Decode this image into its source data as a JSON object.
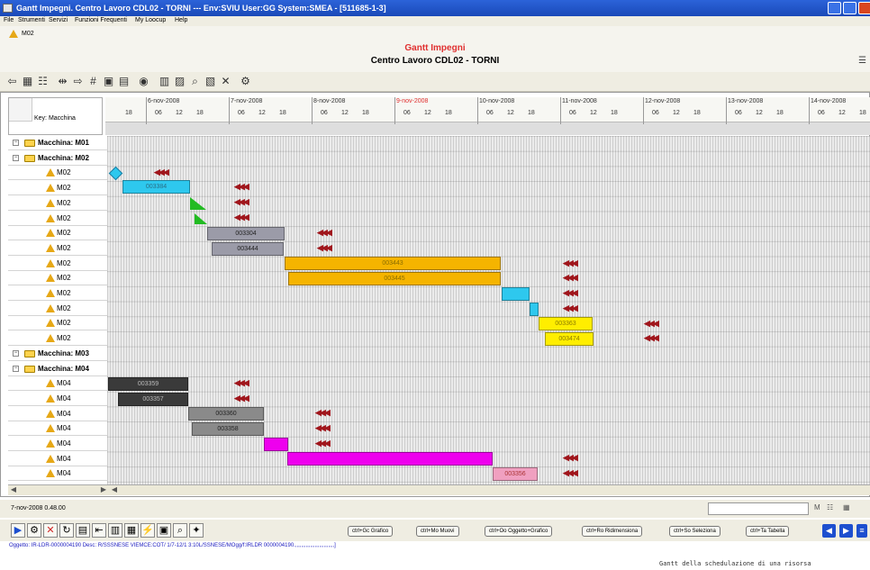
{
  "window": {
    "title": "Gantt Impegni. Centro Lavoro CDL02 - TORNI --- Env:SVIU User:GG System:SMEA - [511685-1-3]"
  },
  "menu": {
    "items": [
      "File",
      "Strumenti",
      "Servizi",
      "Funzioni Frequenti",
      "My Loocup",
      "Help"
    ]
  },
  "doc": {
    "label": "M02"
  },
  "header": {
    "title": "Gantt Impegni",
    "subtitle": "Centro Lavoro CDL02 - TORNI"
  },
  "grid": {
    "key_label": "Key: Macchina",
    "days": [
      "6-nov-2008",
      "7-nov-2008",
      "8-nov-2008",
      "9-nov-2008",
      "10-nov-2008",
      "11-nov-2008",
      "12-nov-2008",
      "13-nov-2008",
      "14-nov-2008"
    ],
    "highlighted_day": "9-nov-2008",
    "hours": [
      "06",
      "12",
      "18"
    ],
    "first_hour": "18"
  },
  "rows": [
    {
      "type": "group",
      "label": "Macchina: M01"
    },
    {
      "type": "group",
      "label": "Macchina: M02"
    },
    {
      "type": "item",
      "label": "M02"
    },
    {
      "type": "item",
      "label": "M02"
    },
    {
      "type": "item",
      "label": "M02"
    },
    {
      "type": "item",
      "label": "M02"
    },
    {
      "type": "item",
      "label": "M02"
    },
    {
      "type": "item",
      "label": "M02"
    },
    {
      "type": "item",
      "label": "M02"
    },
    {
      "type": "item",
      "label": "M02"
    },
    {
      "type": "item",
      "label": "M02"
    },
    {
      "type": "item",
      "label": "M02"
    },
    {
      "type": "item",
      "label": "M02"
    },
    {
      "type": "item",
      "label": "M02"
    },
    {
      "type": "group",
      "label": "Macchina: M03"
    },
    {
      "type": "group",
      "label": "Macchina: M04"
    },
    {
      "type": "item",
      "label": "M04"
    },
    {
      "type": "item",
      "label": "M04"
    },
    {
      "type": "item",
      "label": "M04"
    },
    {
      "type": "item",
      "label": "M04"
    },
    {
      "type": "item",
      "label": "M04"
    },
    {
      "type": "item",
      "label": "M04"
    },
    {
      "type": "item",
      "label": "M04"
    }
  ],
  "bars": {
    "b1": "003384",
    "b2": "003304",
    "b3": "003444",
    "b4": "003443",
    "b5": "003445",
    "b6": "003363",
    "b7": "003474",
    "b8": "003359",
    "b9": "003357",
    "b10": "003360",
    "b11": "003358",
    "b12": "003356"
  },
  "colors": {
    "cyan": "#2ec8ee",
    "green": "#22bb22",
    "slate": "#9b9ba8",
    "orange": "#f5b400",
    "yellow": "#ffee00",
    "dark": "#3a3a3a",
    "gray": "#8a8a8a",
    "magenta": "#ee00ee",
    "pink": "#f0a0c0",
    "marker": "#a0161c"
  },
  "marker_glyph": "◀◀◀",
  "status": {
    "datetime": "7-nov-2008 0.48.00"
  },
  "buttons": [
    "ctrl+Gc Grafico",
    "ctrl+Mo Muovi",
    "ctrl+Oo Oggetto+Grafico",
    "ctrl+Ro Ridimensiona",
    "ctrl+So Seleziona",
    "ctrl+Ta Tabella"
  ],
  "path_line": "Oggetto: IR-LDR-0000004190 Desc: R/SSSNESE VIEMCE:COT/ 1/7-12/1 3:10L/SSNESE/MOgg/f:IRLDR 0000004190.,,,,,,,,,,,,,,,,,,,,,,,,,,]",
  "caption": "Gantt della schedulazione di una risorsa"
}
